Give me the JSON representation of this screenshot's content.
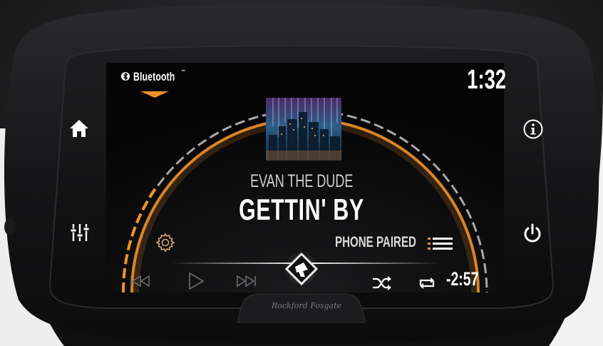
{
  "source": {
    "name": "Bluetooth",
    "trademark": "™"
  },
  "clock": "1:32",
  "now_playing": {
    "artist": "EVAN THE DUDE",
    "title": "GETTIN' BY",
    "status": "PHONE PAIRED",
    "time_remaining": "-2:57"
  },
  "brand": "Rockford Fosgate",
  "icons": {
    "home": "home-icon",
    "eq": "equalizer-icon",
    "info": "info-icon",
    "power": "power-icon",
    "settings": "gear-icon",
    "list": "list-icon",
    "prev": "previous-track-icon",
    "play": "play-icon",
    "next": "next-track-icon",
    "shuffle": "shuffle-icon",
    "repeat": "repeat-icon",
    "logo": "rockford-logo-icon",
    "bluetooth": "bluetooth-icon"
  },
  "colors": {
    "accent": "#f0922b",
    "screen": "#050506",
    "fairing": "#141416"
  }
}
